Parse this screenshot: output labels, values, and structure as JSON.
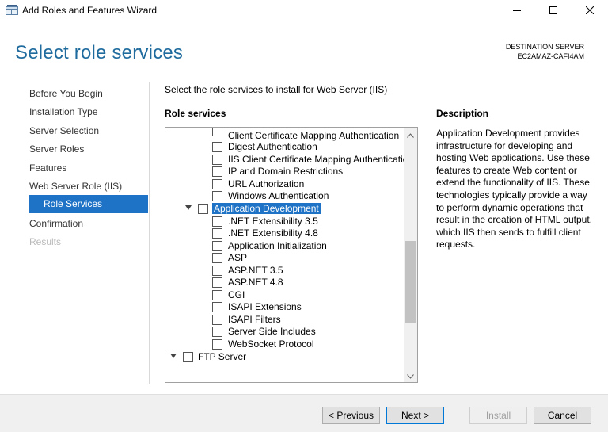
{
  "window": {
    "title": "Add Roles and Features Wizard",
    "controls": [
      "minimize",
      "maximize",
      "close"
    ]
  },
  "header": {
    "page_title": "Select role services",
    "destination_label": "DESTINATION SERVER",
    "destination_server": "EC2AMAZ-CAFI4AM"
  },
  "nav": {
    "items": [
      {
        "label": "Before You Begin",
        "state": "normal"
      },
      {
        "label": "Installation Type",
        "state": "normal"
      },
      {
        "label": "Server Selection",
        "state": "normal"
      },
      {
        "label": "Server Roles",
        "state": "normal"
      },
      {
        "label": "Features",
        "state": "normal"
      },
      {
        "label": "Web Server Role (IIS)",
        "state": "normal"
      },
      {
        "label": "Role Services",
        "state": "active"
      },
      {
        "label": "Confirmation",
        "state": "normal"
      },
      {
        "label": "Results",
        "state": "disabled"
      }
    ]
  },
  "main": {
    "instruction": "Select the role services to install for Web Server (IIS)",
    "role_services_label": "Role services",
    "tree": [
      {
        "label": "Client Certificate Mapping Authentication"
      },
      {
        "label": "Digest Authentication"
      },
      {
        "label": "IIS Client Certificate Mapping Authenticatio"
      },
      {
        "label": "IP and Domain Restrictions"
      },
      {
        "label": "URL Authorization"
      },
      {
        "label": "Windows Authentication"
      },
      {
        "label": "Application Development",
        "selected": true
      },
      {
        "label": ".NET Extensibility 3.5"
      },
      {
        "label": ".NET Extensibility 4.8"
      },
      {
        "label": "Application Initialization"
      },
      {
        "label": "ASP"
      },
      {
        "label": "ASP.NET 3.5"
      },
      {
        "label": "ASP.NET 4.8"
      },
      {
        "label": "CGI"
      },
      {
        "label": "ISAPI Extensions"
      },
      {
        "label": "ISAPI Filters"
      },
      {
        "label": "Server Side Includes"
      },
      {
        "label": "WebSocket Protocol"
      },
      {
        "label": "FTP Server"
      }
    ],
    "description_label": "Description",
    "description_text": "Application Development provides infrastructure for developing and hosting Web applications. Use these features to create Web content or extend the functionality of IIS. These technologies typically provide a way to perform dynamic operations that result in the creation of HTML output, which IIS then sends to fulfill client requests."
  },
  "footer": {
    "previous_label": "< Previous",
    "next_label": "Next >",
    "install_label": "Install",
    "cancel_label": "Cancel"
  },
  "colors": {
    "title_blue": "#1f6b9e",
    "selection_blue": "#1e73c6",
    "footer_bg": "#f0f0f0"
  }
}
